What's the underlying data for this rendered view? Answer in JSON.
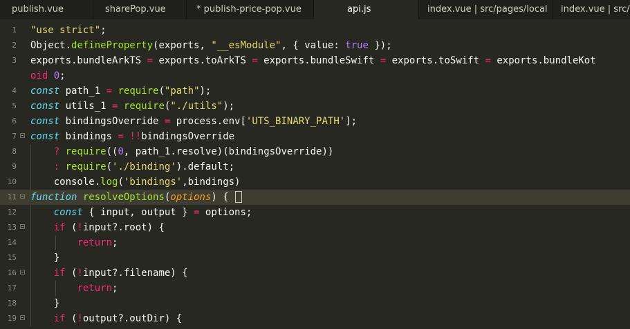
{
  "tabs": [
    {
      "label": "publish.vue",
      "active": false
    },
    {
      "label": "sharePop.vue",
      "active": false
    },
    {
      "label": "* publish-price-pop.vue",
      "active": false
    },
    {
      "label": "api.js",
      "active": true
    },
    {
      "label": "index.vue | src/pages/local",
      "active": false
    },
    {
      "label": "index.vue | src/pa",
      "active": false
    }
  ],
  "editor": {
    "lines": [
      {
        "num": "1",
        "fold": false,
        "tokens": [
          [
            "str",
            "\"use strict\""
          ],
          [
            "plain",
            ";"
          ]
        ]
      },
      {
        "num": "2",
        "fold": false,
        "tokens": [
          [
            "plain",
            "Object."
          ],
          [
            "fn",
            "defineProperty"
          ],
          [
            "plain",
            "(exports, "
          ],
          [
            "str",
            "\"__esModule\""
          ],
          [
            "plain",
            ", { value: "
          ],
          [
            "num",
            "true"
          ],
          [
            "plain",
            " });"
          ]
        ]
      },
      {
        "num": "3",
        "fold": false,
        "tokens": [
          [
            "plain",
            "exports.bundleArkTS "
          ],
          [
            "kw",
            "="
          ],
          [
            "plain",
            " exports.toArkTS "
          ],
          [
            "kw",
            "="
          ],
          [
            "plain",
            " exports.bundleSwift "
          ],
          [
            "kw",
            "="
          ],
          [
            "plain",
            " exports.toSwift "
          ],
          [
            "kw",
            "="
          ],
          [
            "plain",
            " exports.bundleKot"
          ]
        ]
      },
      {
        "num": "",
        "fold": false,
        "tokens": [
          [
            "kw",
            "oid "
          ],
          [
            "num",
            "0"
          ],
          [
            "plain",
            ";"
          ]
        ]
      },
      {
        "num": "4",
        "fold": false,
        "tokens": [
          [
            "storage",
            "const"
          ],
          [
            "plain",
            " path_1 "
          ],
          [
            "kw",
            "="
          ],
          [
            "plain",
            " "
          ],
          [
            "fn",
            "require"
          ],
          [
            "plain",
            "("
          ],
          [
            "str",
            "\"path\""
          ],
          [
            "plain",
            ");"
          ]
        ]
      },
      {
        "num": "5",
        "fold": false,
        "tokens": [
          [
            "storage",
            "const"
          ],
          [
            "plain",
            " utils_1 "
          ],
          [
            "kw",
            "="
          ],
          [
            "plain",
            " "
          ],
          [
            "fn",
            "require"
          ],
          [
            "plain",
            "("
          ],
          [
            "str",
            "\"./utils\""
          ],
          [
            "plain",
            ");"
          ]
        ]
      },
      {
        "num": "6",
        "fold": false,
        "tokens": [
          [
            "storage",
            "const"
          ],
          [
            "plain",
            " bindingsOverride "
          ],
          [
            "kw",
            "="
          ],
          [
            "plain",
            " process.env["
          ],
          [
            "str",
            "'UTS_BINARY_PATH'"
          ],
          [
            "plain",
            "];"
          ]
        ]
      },
      {
        "num": "7",
        "fold": true,
        "tokens": [
          [
            "storage",
            "const"
          ],
          [
            "plain",
            " bindings "
          ],
          [
            "kw",
            "="
          ],
          [
            "plain",
            " "
          ],
          [
            "kw",
            "!!"
          ],
          [
            "plain",
            "bindingsOverride"
          ]
        ]
      },
      {
        "num": "8",
        "fold": false,
        "tokens": [
          [
            "plain",
            "    "
          ],
          [
            "kw",
            "?"
          ],
          [
            "plain",
            " "
          ],
          [
            "fn",
            "require"
          ],
          [
            "plain",
            "(("
          ],
          [
            "num",
            "0"
          ],
          [
            "plain",
            ", path_1.resolve)(bindingsOverride))"
          ]
        ]
      },
      {
        "num": "9",
        "fold": false,
        "tokens": [
          [
            "plain",
            "    "
          ],
          [
            "kw",
            ":"
          ],
          [
            "plain",
            " "
          ],
          [
            "fn",
            "require"
          ],
          [
            "plain",
            "("
          ],
          [
            "str",
            "'./binding'"
          ],
          [
            "plain",
            ").default;"
          ]
        ]
      },
      {
        "num": "10",
        "fold": false,
        "tokens": [
          [
            "plain",
            "    console."
          ],
          [
            "fn",
            "log"
          ],
          [
            "plain",
            "("
          ],
          [
            "str",
            "'bindings'"
          ],
          [
            "plain",
            ",bindings)"
          ]
        ]
      },
      {
        "num": "11",
        "fold": true,
        "cur": true,
        "tokens": [
          [
            "storage",
            "function"
          ],
          [
            "plain",
            " "
          ],
          [
            "fn",
            "resolveOptions"
          ],
          [
            "plain",
            "("
          ],
          [
            "param",
            "options"
          ],
          [
            "plain",
            ") {"
          ]
        ]
      },
      {
        "num": "12",
        "fold": false,
        "tokens": [
          [
            "plain",
            "    "
          ],
          [
            "storage",
            "const"
          ],
          [
            "plain",
            " { input, output } "
          ],
          [
            "kw",
            "="
          ],
          [
            "plain",
            " options;"
          ]
        ]
      },
      {
        "num": "13",
        "fold": true,
        "tokens": [
          [
            "plain",
            "    "
          ],
          [
            "kw",
            "if"
          ],
          [
            "plain",
            " ("
          ],
          [
            "kw",
            "!"
          ],
          [
            "plain",
            "input?.root) {"
          ]
        ]
      },
      {
        "num": "14",
        "fold": false,
        "tokens": [
          [
            "plain",
            "        "
          ],
          [
            "kw",
            "return"
          ],
          [
            "plain",
            ";"
          ]
        ]
      },
      {
        "num": "15",
        "fold": false,
        "tokens": [
          [
            "plain",
            "    }"
          ]
        ]
      },
      {
        "num": "16",
        "fold": true,
        "tokens": [
          [
            "plain",
            "    "
          ],
          [
            "kw",
            "if"
          ],
          [
            "plain",
            " ("
          ],
          [
            "kw",
            "!"
          ],
          [
            "plain",
            "input?.filename) {"
          ]
        ]
      },
      {
        "num": "17",
        "fold": false,
        "tokens": [
          [
            "plain",
            "        "
          ],
          [
            "kw",
            "return"
          ],
          [
            "plain",
            ";"
          ]
        ]
      },
      {
        "num": "18",
        "fold": false,
        "tokens": [
          [
            "plain",
            "    }"
          ]
        ]
      },
      {
        "num": "19",
        "fold": true,
        "tokens": [
          [
            "plain",
            "    "
          ],
          [
            "kw",
            "if"
          ],
          [
            "plain",
            " ("
          ],
          [
            "kw",
            "!"
          ],
          [
            "plain",
            "output?.outDir) {"
          ]
        ]
      }
    ]
  }
}
